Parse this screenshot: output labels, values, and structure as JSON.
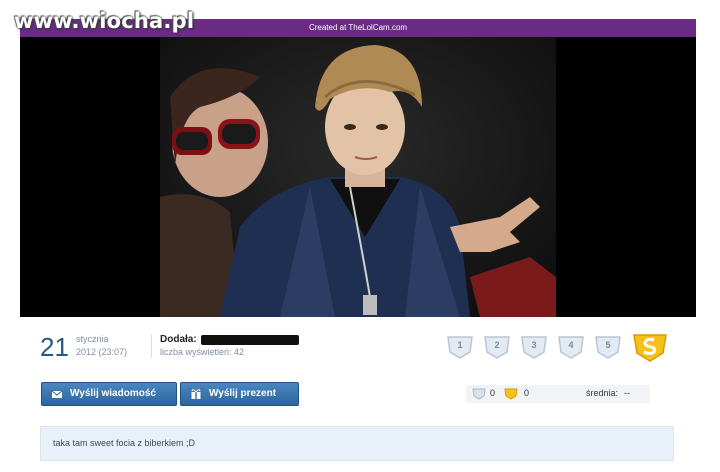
{
  "watermark": {
    "text": "www.wiocha.pl"
  },
  "photo": {
    "caption": "Created at TheLolCam.com"
  },
  "meta": {
    "day": "21",
    "month": "stycznia",
    "year_time": "2012 (23:07)",
    "added_label": "Dodała:",
    "views_label": "liczba wyświetleń:",
    "views_count": "42"
  },
  "rating": {
    "stars": [
      "1",
      "2",
      "3",
      "4",
      "5"
    ],
    "super_icon": "super-badge-icon"
  },
  "actions": {
    "send_message": "Wyślij wiadomość",
    "send_gift": "Wyślij prezent"
  },
  "stats": {
    "votes": "0",
    "super_votes": "0",
    "average_label": "średnia:",
    "average_value": "--"
  },
  "comment": {
    "text": "taka tam sweet focia z biberkiem ;D"
  },
  "colors": {
    "accent": "#2d669f",
    "lolcam_bar": "#6a2a86",
    "day": "#26598a",
    "super": "#f0b400"
  }
}
